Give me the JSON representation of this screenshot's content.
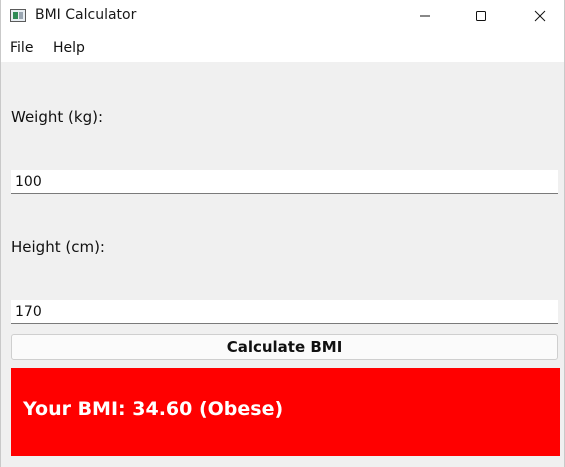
{
  "window": {
    "title": "BMI Calculator",
    "app_icon": "app-window-icon",
    "controls": {
      "minimize_icon": "minimize-icon",
      "maximize_icon": "maximize-icon",
      "close_icon": "close-icon"
    }
  },
  "menubar": {
    "items": [
      {
        "label": "File"
      },
      {
        "label": "Help"
      }
    ]
  },
  "form": {
    "weight": {
      "label": "Weight (kg):",
      "value": "100"
    },
    "height": {
      "label": "Height (cm):",
      "value": "170"
    },
    "calculate_button": "Calculate BMI"
  },
  "result": {
    "text": "Your BMI: 34.60 (Obese)",
    "background_color": "#ff0000",
    "text_color": "#ffffff"
  }
}
